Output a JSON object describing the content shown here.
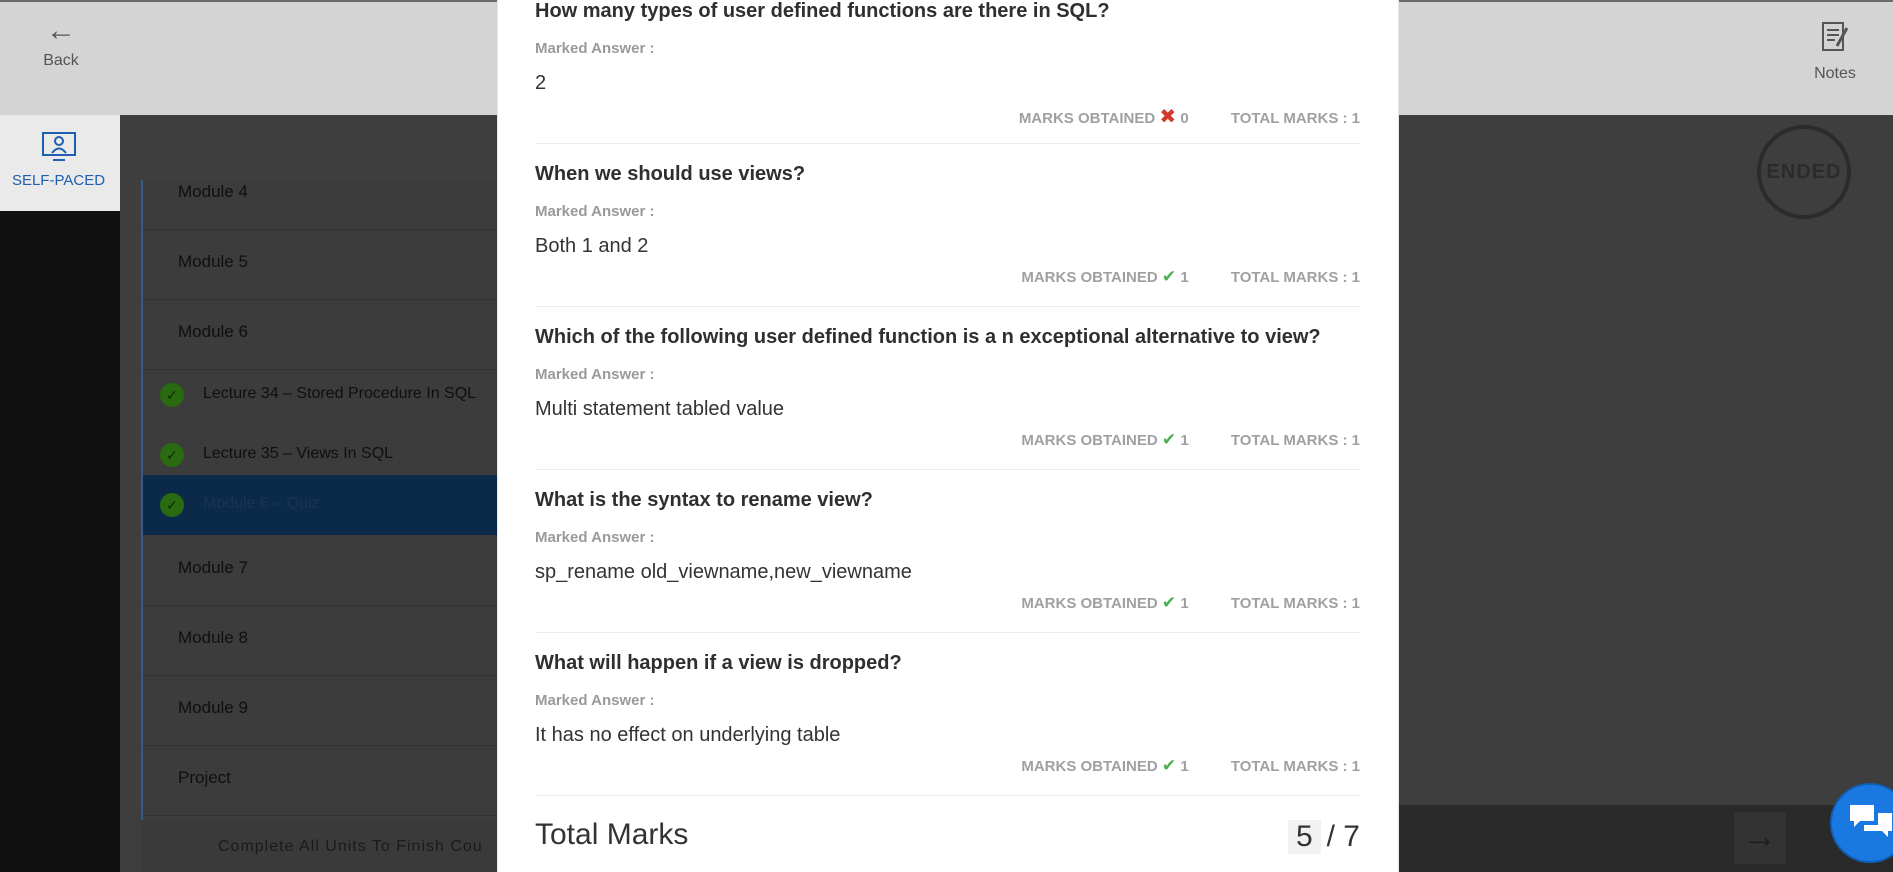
{
  "header": {
    "back_label": "Back",
    "notes_label": "Notes"
  },
  "sidenav": {
    "self_paced_label": "SELF-PACED"
  },
  "course_nav": {
    "modules_top": [
      {
        "label": "Module 4"
      },
      {
        "label": "Module 5"
      },
      {
        "label": "Module 6"
      }
    ],
    "lectures": [
      {
        "label": "Lecture 34 – Stored Procedure In SQL",
        "completed": true
      },
      {
        "label": "Lecture 35 – Views In SQL",
        "completed": true
      },
      {
        "label": "Module 6 – Quiz",
        "completed": true,
        "active": true
      }
    ],
    "modules_bottom": [
      {
        "label": "Module 7"
      },
      {
        "label": "Module 8"
      },
      {
        "label": "Module 9"
      },
      {
        "label": "Project"
      }
    ],
    "footer_text": "Complete All Units To Finish Cou"
  },
  "status_badge": "ENDED",
  "quiz_results": {
    "marked_answer_label": "Marked Answer :",
    "marks_obtained_label": "MARKS OBTAINED",
    "total_marks_prefix": "TOTAL MARKS : ",
    "questions": [
      {
        "question": "How many types of user defined functions are there in SQL?",
        "answer": "2",
        "correct": false,
        "obtained": "0",
        "total": "1"
      },
      {
        "question": "When we should use views?",
        "answer": "Both 1 and 2",
        "correct": true,
        "obtained": "1",
        "total": "1"
      },
      {
        "question": "Which of the following user defined function is a n exceptional alternative to view?",
        "answer": "Multi statement tabled value",
        "correct": true,
        "obtained": "1",
        "total": "1"
      },
      {
        "question": "What is the syntax to rename view?",
        "answer": "sp_rename old_viewname,new_viewname",
        "correct": true,
        "obtained": "1",
        "total": "1"
      },
      {
        "question": "What will happen if a view is dropped?",
        "answer": "It has no effect on underlying table",
        "correct": true,
        "obtained": "1",
        "total": "1"
      }
    ],
    "total_label": "Total Marks",
    "total_obtained": "5",
    "total_possible": "/ 7"
  },
  "colors": {
    "correct": "#4caf50",
    "wrong": "#d0392b",
    "accent": "#1a79e0"
  }
}
